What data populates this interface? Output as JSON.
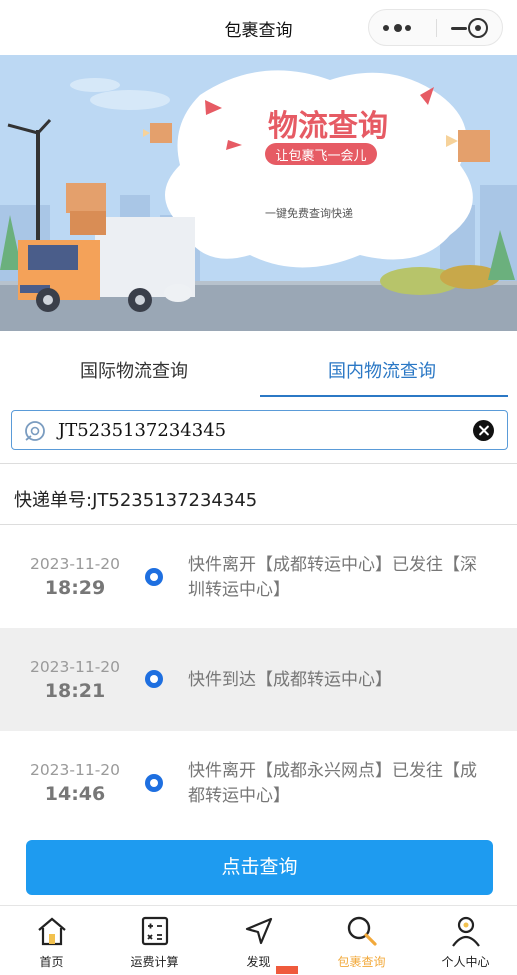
{
  "header": {
    "title": "包裹查询"
  },
  "banner": {
    "headline": "物流查询",
    "slogan": "让包裹飞一会儿",
    "subtext": "一键免费查询快递"
  },
  "tabs": [
    {
      "label": "国际物流查询",
      "active": false
    },
    {
      "label": "国内物流查询",
      "active": true
    }
  ],
  "search": {
    "value": "JT5235137234345"
  },
  "tracking": {
    "label": "快递单号:JT5235137234345"
  },
  "events": [
    {
      "date": "2023-11-20",
      "time": "18:29",
      "desc": "快件离开【成都转运中心】已发往【深圳转运中心】"
    },
    {
      "date": "2023-11-20",
      "time": "18:21",
      "desc": "快件到达【成都转运中心】"
    },
    {
      "date": "2023-11-20",
      "time": "14:46",
      "desc": "快件离开【成都永兴网点】已发往【成都转运中心】"
    }
  ],
  "query_button": {
    "label": "点击查询"
  },
  "tabbar": [
    {
      "label": "首页",
      "icon": "home-icon",
      "active": false
    },
    {
      "label": "运费计算",
      "icon": "calculator-icon",
      "active": false
    },
    {
      "label": "发现",
      "icon": "navigation-arrow-icon",
      "active": false
    },
    {
      "label": "包裹查询",
      "icon": "search-icon",
      "active": true
    },
    {
      "label": "个人中心",
      "icon": "user-icon",
      "active": false
    }
  ],
  "colors": {
    "accent": "#2b78c5",
    "button": "#1e9bf0",
    "active_tab": "#f2a93b",
    "timeline_dot": "#1e6fe0",
    "headline": "#e65b64"
  }
}
